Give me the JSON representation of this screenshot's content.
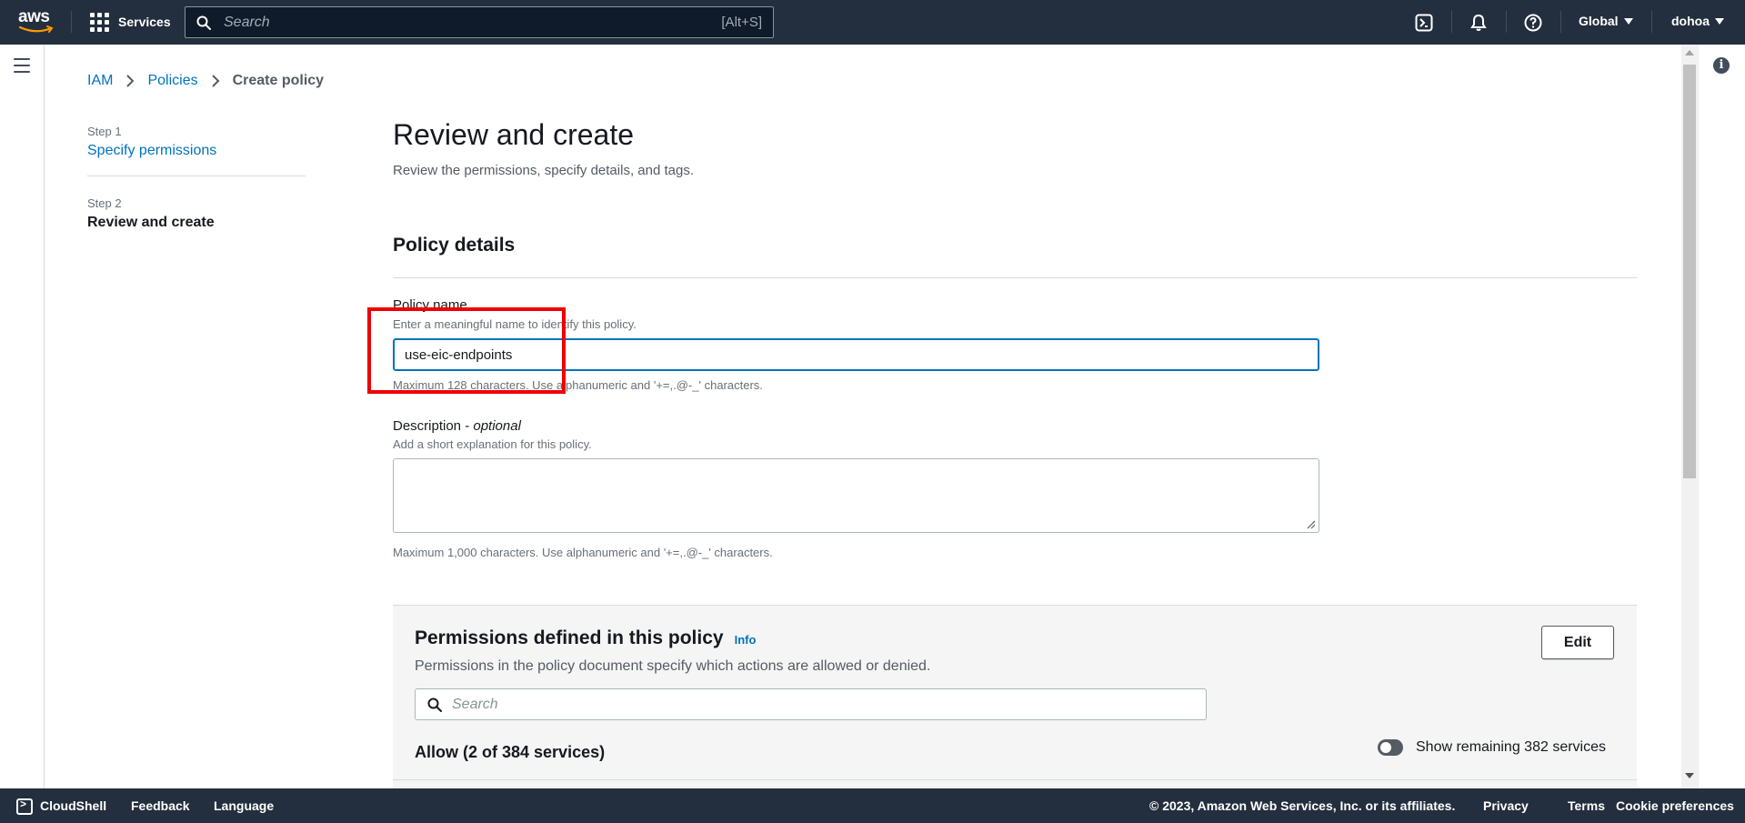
{
  "nav": {
    "logo_text": "aws",
    "services_label": "Services",
    "search_placeholder": "Search",
    "search_shortcut": "[Alt+S]",
    "region_label": "Global",
    "account_label": "dohoa"
  },
  "breadcrumb": {
    "items": [
      "IAM",
      "Policies"
    ],
    "current": "Create policy"
  },
  "steps": [
    {
      "label": "Step 1",
      "title": "Specify permissions"
    },
    {
      "label": "Step 2",
      "title": "Review and create"
    }
  ],
  "page": {
    "title": "Review and create",
    "subtitle": "Review the permissions, specify details, and tags."
  },
  "policy_details": {
    "section_title": "Policy details",
    "name_label": "Policy name",
    "name_description": "Enter a meaningful name to identify this policy.",
    "name_value": "use-eic-endpoints",
    "name_constraint": "Maximum 128 characters. Use alphanumeric and '+=,.@-_' characters.",
    "desc_label": "Description - ",
    "desc_optional": "optional",
    "desc_description": "Add a short explanation for this policy.",
    "desc_value": "",
    "desc_constraint": "Maximum 1,000 characters. Use alphanumeric and '+=,.@-_' characters."
  },
  "permissions": {
    "title": "Permissions defined in this policy",
    "info_label": "Info",
    "description": "Permissions in the policy document specify which actions are allowed or denied.",
    "edit_label": "Edit",
    "search_placeholder": "Search",
    "allow_title": "Allow (2 of 384 services)",
    "toggle_label": "Show remaining 382 services"
  },
  "footer": {
    "cloudshell": "CloudShell",
    "feedback": "Feedback",
    "language": "Language",
    "copyright": "© 2023, Amazon Web Services, Inc. or its affiliates.",
    "privacy": "Privacy",
    "terms": "Terms",
    "cookie": "Cookie preferences"
  },
  "colors": {
    "nav_bg": "#232f3e",
    "link": "#0073bb",
    "highlight": "#ee0000"
  },
  "icons": [
    "aws-logo",
    "services-grid-icon",
    "search-icon",
    "cloudshell-icon",
    "bell-icon",
    "help-icon",
    "menu-icon",
    "info-icon",
    "chevron-right-icon",
    "resize-grip-icon"
  ]
}
